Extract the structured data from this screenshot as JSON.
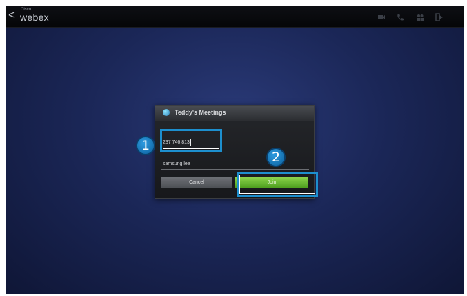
{
  "topbar": {
    "back_icon": "<",
    "brand_small": "Cisco",
    "brand": "webex",
    "icons": [
      "video-icon",
      "phone-icon",
      "participants-icon",
      "exit-icon"
    ]
  },
  "dialog": {
    "title": "Teddy's Meetings",
    "meeting_number": "237 746 813",
    "name_value": "samsung lee",
    "cancel_label": "Cancel",
    "join_label": "Join"
  },
  "callouts": {
    "one": "1",
    "two": "2"
  },
  "colors": {
    "accent": "#1d8fce",
    "join_green": "#5fb52a",
    "background": "#1b2758"
  }
}
